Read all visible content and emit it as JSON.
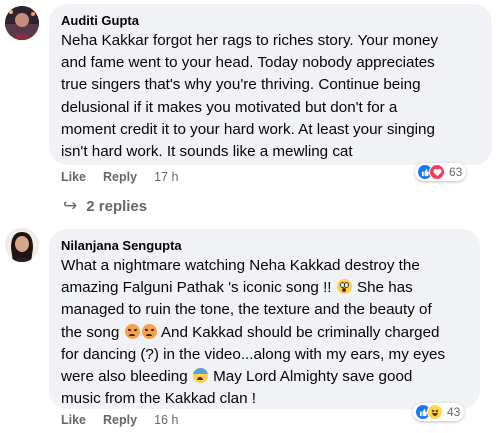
{
  "comments": [
    {
      "author": "Auditi Gupta",
      "lines": [
        "Neha Kakkar forgot her rags to riches story. Your money",
        "and fame went to your head. Today nobody appreciates",
        "true singers that's why you're thriving. Continue being",
        "delusional if it makes you motivated but don't for a",
        "moment credit it to your hard work. At least your singing",
        "isn't hard work. It sounds like a mewling cat"
      ],
      "like_label": "Like",
      "reply_label": "Reply",
      "time": "17 h",
      "reaction_icons": [
        "like-icon",
        "love-icon"
      ],
      "reaction_count": "63",
      "replies_label": "2 replies"
    },
    {
      "author": "Nilanjana Sengupta",
      "segments": {
        "l1": "What a nightmare watching Neha Kakkad destroy the",
        "l2a": "amazing Falguni Pathak 's iconic song !!",
        "l2b": " She has",
        "l3": "managed to ruin the tone, the texture and the beauty of",
        "l4a": "the song",
        "l4b": " And Kakkad should be criminally charged",
        "l5": "for dancing (?) in the video...along with my ears, my eyes",
        "l6a": "were also bleeding",
        "l6b": " May Lord Almighty save good",
        "l7": "music from the Kakkad clan !"
      },
      "emoji_names": [
        "screaming-face-emoji",
        "angry-face-emoji",
        "fearful-face-emoji"
      ],
      "like_label": "Like",
      "reply_label": "Reply",
      "time": "16 h",
      "reaction_icons": [
        "like-icon",
        "haha-icon"
      ],
      "reaction_count": "43"
    }
  ],
  "colors": {
    "bubble": "#f0f2f5",
    "meta": "#65676b",
    "like": "#1877f2",
    "love": "#f33e58",
    "haha": "#ffd84a"
  }
}
